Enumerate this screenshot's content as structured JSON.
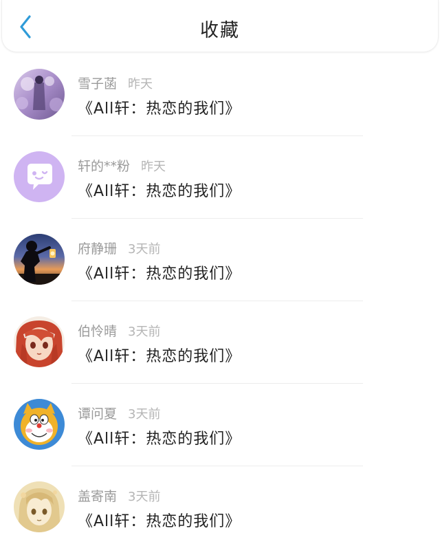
{
  "header": {
    "title": "收藏",
    "back_icon": "chevron-left-icon"
  },
  "colors": {
    "accent": "#2f9bd8",
    "name_text": "#9a9a9a",
    "title_text": "#222222"
  },
  "favorites": [
    {
      "user": "雪子菡",
      "time": "昨天",
      "work": "《All轩：热恋的我们》",
      "avatar": "purple-fantasy-avatar"
    },
    {
      "user": "轩的**粉",
      "time": "昨天",
      "work": "《All轩：热恋的我们》",
      "avatar": "lavender-chat-bubble-avatar"
    },
    {
      "user": "府静珊",
      "time": "3天前",
      "work": "《All轩：热恋的我们》",
      "avatar": "sunset-silhouette-lantern-avatar"
    },
    {
      "user": "伯怜晴",
      "time": "3天前",
      "work": "《All轩：热恋的我们》",
      "avatar": "red-hair-anime-girl-avatar"
    },
    {
      "user": "谭问夏",
      "time": "3天前",
      "work": "《All轩：热恋的我们》",
      "avatar": "doraemon-avatar"
    },
    {
      "user": "盖寄南",
      "time": "3天前",
      "work": "《All轩：热恋的我们》",
      "avatar": "sketch-anime-girl-avatar"
    }
  ]
}
